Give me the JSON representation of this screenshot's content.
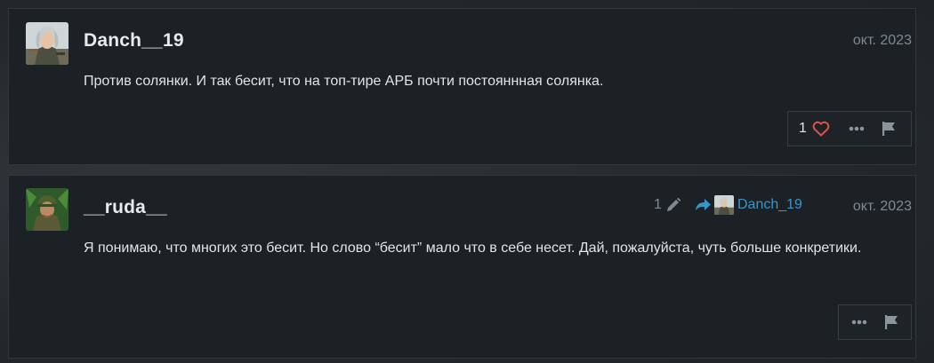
{
  "posts": [
    {
      "username": "Danch__19",
      "date": "окт. 2023",
      "text": "Против солянки. И так бесит, что на топ-тире АРБ почти постояннная солянка.",
      "likes": "1",
      "avatar_icon": "soldier-avatar-icon"
    },
    {
      "username": "__ruda__",
      "date": "окт. 2023",
      "text": "Я понимаю, что многих это бесит. Но слово “бесит” мало что в себе несет. Дай, пожалуйста, чуть больше конкретики.",
      "edit_count": "1",
      "reply_to": "Danch_19",
      "avatar_icon": "jungle-soldier-avatar-icon"
    }
  ],
  "colors": {
    "background": "#1b2124",
    "border": "#31383c",
    "heart": "#e0514a",
    "link": "#3a95c9",
    "muted": "#7f8a90"
  }
}
